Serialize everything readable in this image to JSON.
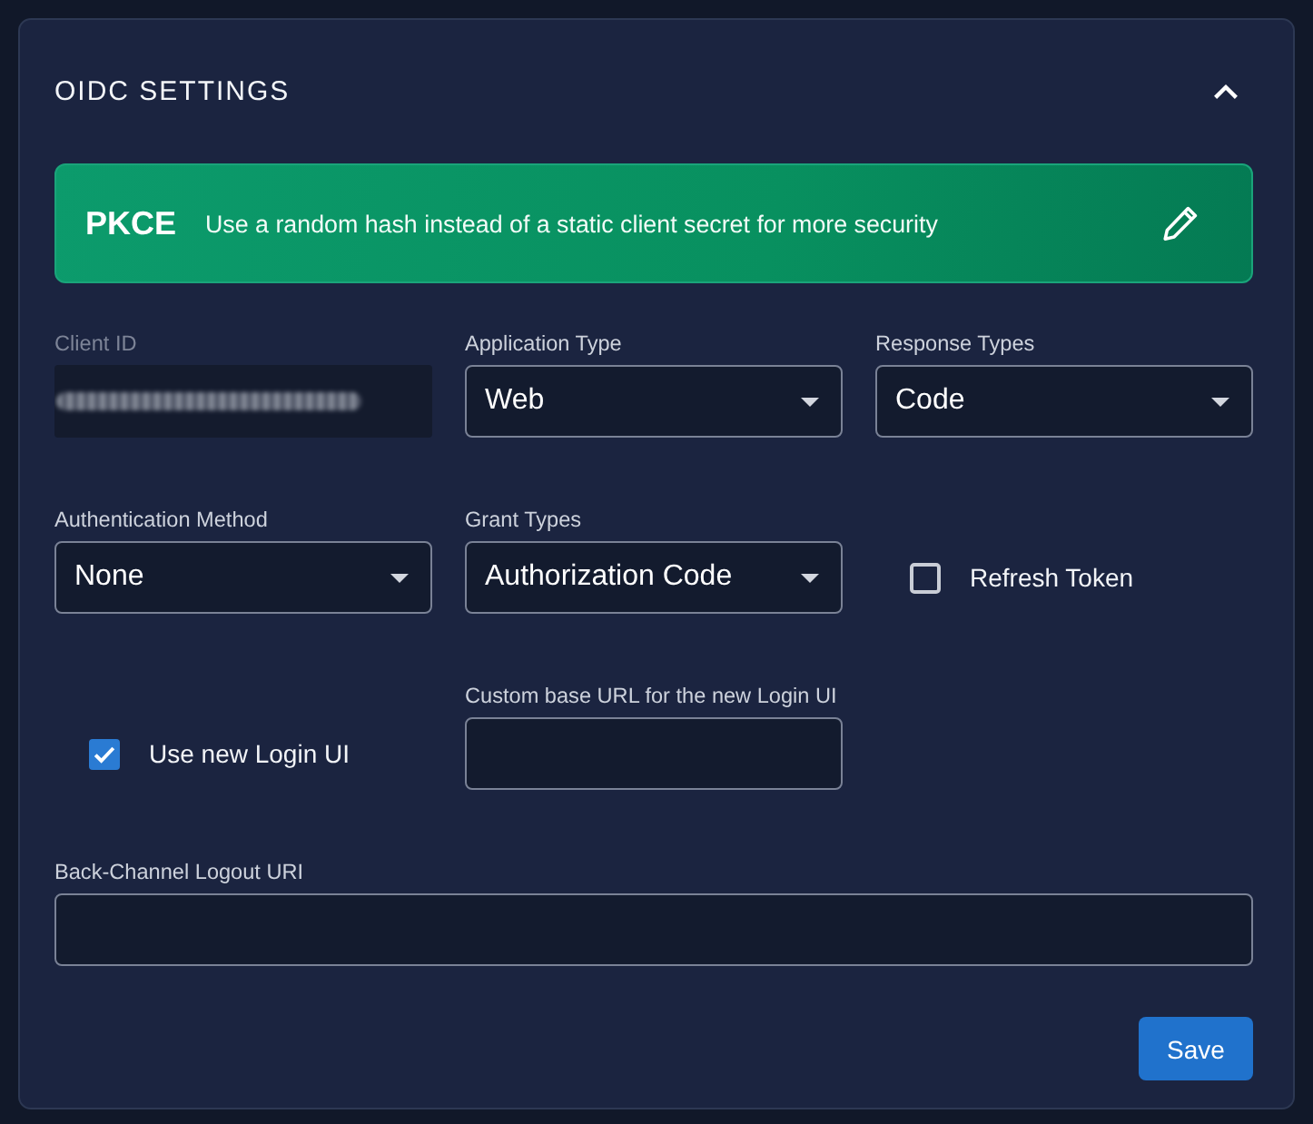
{
  "section": {
    "title": "OIDC SETTINGS",
    "expanded": true
  },
  "pkce_banner": {
    "title": "PKCE",
    "description": "Use a random hash instead of a static client secret for more security"
  },
  "rows": [
    [
      {
        "kind": "redacted",
        "label": "Client ID",
        "disabled": true
      },
      {
        "kind": "select",
        "label": "Application Type",
        "value": "Web",
        "disabled": false
      },
      {
        "kind": "select",
        "label": "Response Types",
        "value": "Code",
        "disabled": false
      }
    ],
    [
      {
        "kind": "select",
        "label": "Authentication Method",
        "value": "None",
        "disabled": false
      },
      {
        "kind": "select",
        "label": "Grant Types",
        "value": "Authorization Code",
        "disabled": false
      },
      {
        "kind": "checkbox",
        "label": "Refresh Token",
        "checked": false,
        "disabled": false
      }
    ],
    [
      {
        "kind": "checkbox",
        "label": "Use new Login UI",
        "checked": true,
        "disabled": false
      },
      {
        "kind": "text",
        "label": "Custom base URL for the new Login UI",
        "disabled": false
      }
    ],
    [
      {
        "kind": "text",
        "label": "Back-Channel Logout URI",
        "disabled": false
      }
    ]
  ],
  "buttons": [
    {
      "label": "Save"
    }
  ]
}
